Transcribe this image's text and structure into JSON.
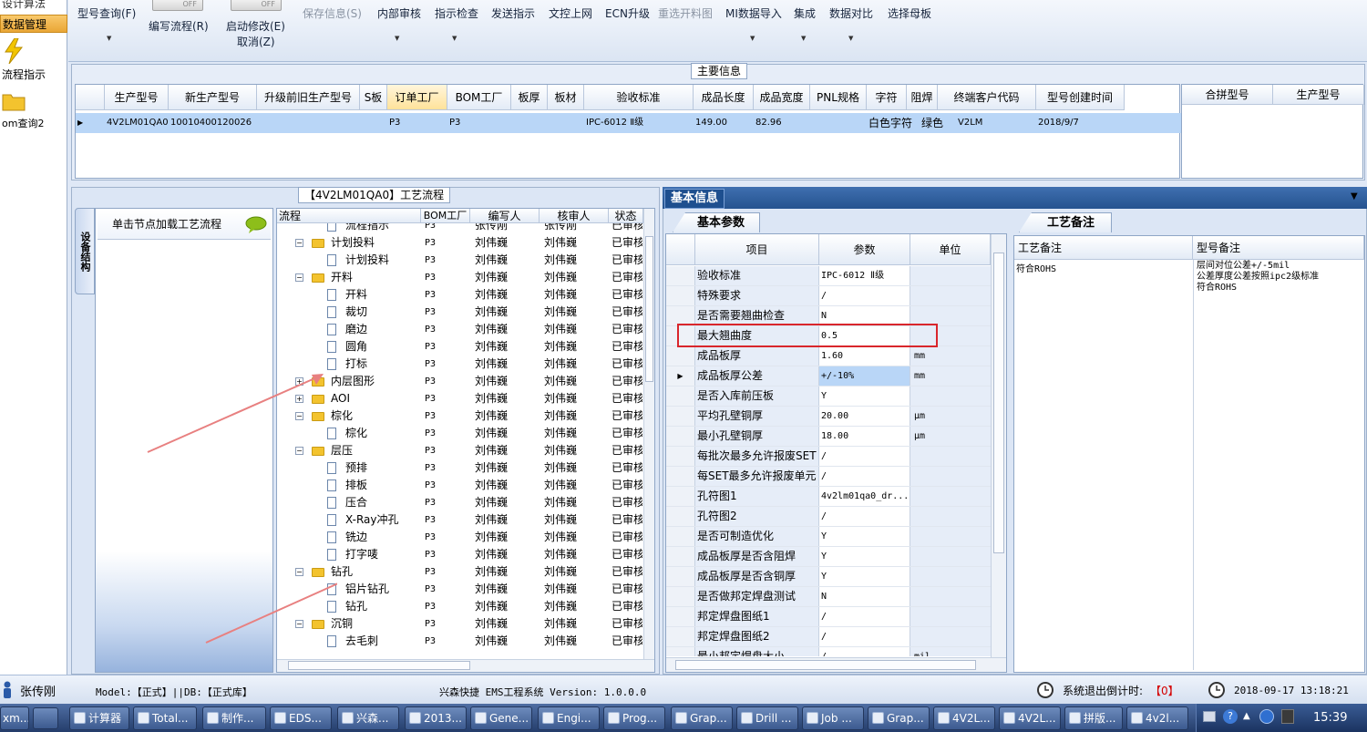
{
  "left_nav": {
    "items": [
      "设计算法",
      "数据管理",
      "流程指示",
      "om查询2"
    ]
  },
  "toolbar": {
    "buttons": [
      {
        "label": "型号查询(F)",
        "dropdown": true,
        "enabled": true
      },
      {
        "label": "编写流程(R)",
        "toggle": "OFF",
        "enabled": true
      },
      {
        "label": "启动修改(E)",
        "sub": "取消(Z)",
        "toggle": "OFF",
        "enabled": true
      },
      {
        "label": "保存信息(S)",
        "enabled": false
      },
      {
        "label": "内部审核",
        "dropdown": true,
        "enabled": true
      },
      {
        "label": "指示检查",
        "dropdown": true,
        "enabled": true
      },
      {
        "label": "发送指示",
        "enabled": true
      },
      {
        "label": "文控上网",
        "enabled": true
      },
      {
        "label": "ECN升级",
        "enabled": true
      },
      {
        "label": "重选开料图",
        "enabled": false
      },
      {
        "label": "MI数据导入",
        "dropdown": true,
        "enabled": true
      },
      {
        "label": "集成",
        "dropdown": true,
        "enabled": true
      },
      {
        "label": "数据对比",
        "dropdown": true,
        "enabled": true
      },
      {
        "label": "选择母板",
        "enabled": true
      }
    ]
  },
  "main_info": {
    "title": "主要信息",
    "columns": [
      "生产型号",
      "新生产型号",
      "升级前旧生产型号",
      "S板",
      "订单工厂",
      "BOM工厂",
      "板厚",
      "板材",
      "验收标准",
      "成品长度",
      "成品宽度",
      "PNL规格",
      "字符",
      "阻焊",
      "终端客户代码",
      "型号创建时间"
    ],
    "row": [
      "4V2LM01QA0",
      "10010400120026",
      "",
      "",
      "P3",
      "P3",
      "",
      "",
      "IPC-6012 Ⅱ级",
      "149.00",
      "82.96",
      "",
      "白色字符",
      "绿色",
      "V2LM",
      "2018/9/7"
    ],
    "side_columns": [
      "合拼型号",
      "生产型号"
    ]
  },
  "process": {
    "title": "【4V2LM01QA0】工艺流程",
    "side_tab": "设备结构",
    "hint": "单击节点加载工艺流程",
    "columns": [
      "流程",
      "BOM工厂",
      "编写人",
      "核审人",
      "状态"
    ],
    "rows": [
      {
        "name": "流程指示",
        "level": 2,
        "type": "doc",
        "bom": "P3",
        "writer": "张传刚",
        "reviewer": "张传刚",
        "status": "已审核"
      },
      {
        "name": "计划投料",
        "level": 1,
        "type": "folder",
        "bom": "P3",
        "writer": "刘伟巍",
        "reviewer": "刘伟巍",
        "status": "已审核"
      },
      {
        "name": "计划投料",
        "level": 2,
        "type": "doc",
        "bom": "P3",
        "writer": "刘伟巍",
        "reviewer": "刘伟巍",
        "status": "已审核"
      },
      {
        "name": "开料",
        "level": 1,
        "type": "folder",
        "bom": "P3",
        "writer": "刘伟巍",
        "reviewer": "刘伟巍",
        "status": "已审核"
      },
      {
        "name": "开料",
        "level": 2,
        "type": "doc",
        "bom": "P3",
        "writer": "刘伟巍",
        "reviewer": "刘伟巍",
        "status": "已审核"
      },
      {
        "name": "裁切",
        "level": 2,
        "type": "doc",
        "bom": "P3",
        "writer": "刘伟巍",
        "reviewer": "刘伟巍",
        "status": "已审核"
      },
      {
        "name": "磨边",
        "level": 2,
        "type": "doc",
        "bom": "P3",
        "writer": "刘伟巍",
        "reviewer": "刘伟巍",
        "status": "已审核"
      },
      {
        "name": "圆角",
        "level": 2,
        "type": "doc",
        "bom": "P3",
        "writer": "刘伟巍",
        "reviewer": "刘伟巍",
        "status": "已审核"
      },
      {
        "name": "打标",
        "level": 2,
        "type": "doc",
        "bom": "P3",
        "writer": "刘伟巍",
        "reviewer": "刘伟巍",
        "status": "已审核"
      },
      {
        "name": "内层图形",
        "level": 1,
        "type": "folder",
        "collapsed": true,
        "bom": "P3",
        "writer": "刘伟巍",
        "reviewer": "刘伟巍",
        "status": "已审核"
      },
      {
        "name": "AOI",
        "level": 1,
        "type": "folder",
        "collapsed": true,
        "bom": "P3",
        "writer": "刘伟巍",
        "reviewer": "刘伟巍",
        "status": "已审核"
      },
      {
        "name": "棕化",
        "level": 1,
        "type": "folder",
        "bom": "P3",
        "writer": "刘伟巍",
        "reviewer": "刘伟巍",
        "status": "已审核"
      },
      {
        "name": "棕化",
        "level": 2,
        "type": "doc",
        "bom": "P3",
        "writer": "刘伟巍",
        "reviewer": "刘伟巍",
        "status": "已审核"
      },
      {
        "name": "层压",
        "level": 1,
        "type": "folder",
        "bom": "P3",
        "writer": "刘伟巍",
        "reviewer": "刘伟巍",
        "status": "已审核"
      },
      {
        "name": "预排",
        "level": 2,
        "type": "doc",
        "bom": "P3",
        "writer": "刘伟巍",
        "reviewer": "刘伟巍",
        "status": "已审核"
      },
      {
        "name": "排板",
        "level": 2,
        "type": "doc",
        "bom": "P3",
        "writer": "刘伟巍",
        "reviewer": "刘伟巍",
        "status": "已审核"
      },
      {
        "name": "压合",
        "level": 2,
        "type": "doc",
        "bom": "P3",
        "writer": "刘伟巍",
        "reviewer": "刘伟巍",
        "status": "已审核"
      },
      {
        "name": "X-Ray冲孔",
        "level": 2,
        "type": "doc",
        "bom": "P3",
        "writer": "刘伟巍",
        "reviewer": "刘伟巍",
        "status": "已审核"
      },
      {
        "name": "铣边",
        "level": 2,
        "type": "doc",
        "bom": "P3",
        "writer": "刘伟巍",
        "reviewer": "刘伟巍",
        "status": "已审核"
      },
      {
        "name": "打字唛",
        "level": 2,
        "type": "doc",
        "bom": "P3",
        "writer": "刘伟巍",
        "reviewer": "刘伟巍",
        "status": "已审核"
      },
      {
        "name": "钻孔",
        "level": 1,
        "type": "folder",
        "bom": "P3",
        "writer": "刘伟巍",
        "reviewer": "刘伟巍",
        "status": "已审核"
      },
      {
        "name": "铝片钻孔",
        "level": 2,
        "type": "doc",
        "bom": "P3",
        "writer": "刘伟巍",
        "reviewer": "刘伟巍",
        "status": "已审核"
      },
      {
        "name": "钻孔",
        "level": 2,
        "type": "doc",
        "bom": "P3",
        "writer": "刘伟巍",
        "reviewer": "刘伟巍",
        "status": "已审核"
      },
      {
        "name": "沉铜",
        "level": 1,
        "type": "folder",
        "bom": "P3",
        "writer": "刘伟巍",
        "reviewer": "刘伟巍",
        "status": "已审核"
      },
      {
        "name": "去毛刺",
        "level": 2,
        "type": "doc",
        "bom": "P3",
        "writer": "刘伟巍",
        "reviewer": "刘伟巍",
        "status": "已审核"
      }
    ]
  },
  "basic_info": {
    "title": "基本信息",
    "tab": "基本参数",
    "columns": [
      "项目",
      "参数",
      "单位"
    ],
    "rows": [
      {
        "item": "验收标准",
        "param": "IPC-6012 Ⅱ级",
        "unit": ""
      },
      {
        "item": "特殊要求",
        "param": "/",
        "unit": ""
      },
      {
        "item": "是否需要翘曲检查",
        "param": "N",
        "unit": ""
      },
      {
        "item": "最大翘曲度",
        "param": "0.5",
        "unit": "",
        "highlight": true
      },
      {
        "item": "成品板厚",
        "param": "1.60",
        "unit": "mm"
      },
      {
        "item": "成品板厚公差",
        "param": "+/-10%",
        "unit": "mm",
        "selected": true
      },
      {
        "item": "是否入库前压板",
        "param": "Y",
        "unit": ""
      },
      {
        "item": "平均孔壁铜厚",
        "param": "20.00",
        "unit": "μm"
      },
      {
        "item": "最小孔壁铜厚",
        "param": "18.00",
        "unit": "μm"
      },
      {
        "item": "每批次最多允许报废SET",
        "param": "/",
        "unit": ""
      },
      {
        "item": "每SET最多允许报废单元",
        "param": "/",
        "unit": ""
      },
      {
        "item": "孔符图1",
        "param": "4v2lm01qa0_dr...",
        "unit": ""
      },
      {
        "item": "孔符图2",
        "param": "/",
        "unit": ""
      },
      {
        "item": "是否可制造优化",
        "param": "Y",
        "unit": ""
      },
      {
        "item": "成品板厚是否含阻焊",
        "param": "Y",
        "unit": ""
      },
      {
        "item": "成品板厚是否含铜厚",
        "param": "Y",
        "unit": ""
      },
      {
        "item": "是否做邦定焊盘测试",
        "param": "N",
        "unit": ""
      },
      {
        "item": "邦定焊盘图纸1",
        "param": "/",
        "unit": ""
      },
      {
        "item": "邦定焊盘图纸2",
        "param": "/",
        "unit": ""
      },
      {
        "item": "最小邦定焊盘大小",
        "param": "/",
        "unit": "mil"
      }
    ]
  },
  "process_notes": {
    "tab": "工艺备注",
    "columns": [
      "工艺备注",
      "型号备注"
    ],
    "process_note": "符合ROHS",
    "model_note_lines": [
      "层间对位公差+/-5mil",
      "公差厚度公差按照ipc2级标准",
      "符合ROHS"
    ]
  },
  "status_bar": {
    "user": "张传刚",
    "model": "Model:【正式】||DB:【正式库】",
    "app": "兴森快捷 EMS工程系统 Version: 1.0.0.0",
    "countdown_label": "系统退出倒计时:",
    "countdown_value": "【0】",
    "datetime": "2018-09-17 13:18:21"
  },
  "taskbar": {
    "items": [
      "xm...",
      "计算器",
      "Total...",
      "制作...",
      "EDS...",
      "兴森...",
      "2013...",
      "Gene...",
      "Engi...",
      "Prog...",
      "Grap...",
      "Drill ...",
      "Job ...",
      "Grap...",
      "4V2L...",
      "4V2L...",
      "拼版...",
      "4v2l..."
    ],
    "clock": "15:39"
  },
  "colors": {
    "highlight_box": "#d9262c",
    "selected_row": "#b9d6f7",
    "annotation_arrow": "#e88080"
  }
}
